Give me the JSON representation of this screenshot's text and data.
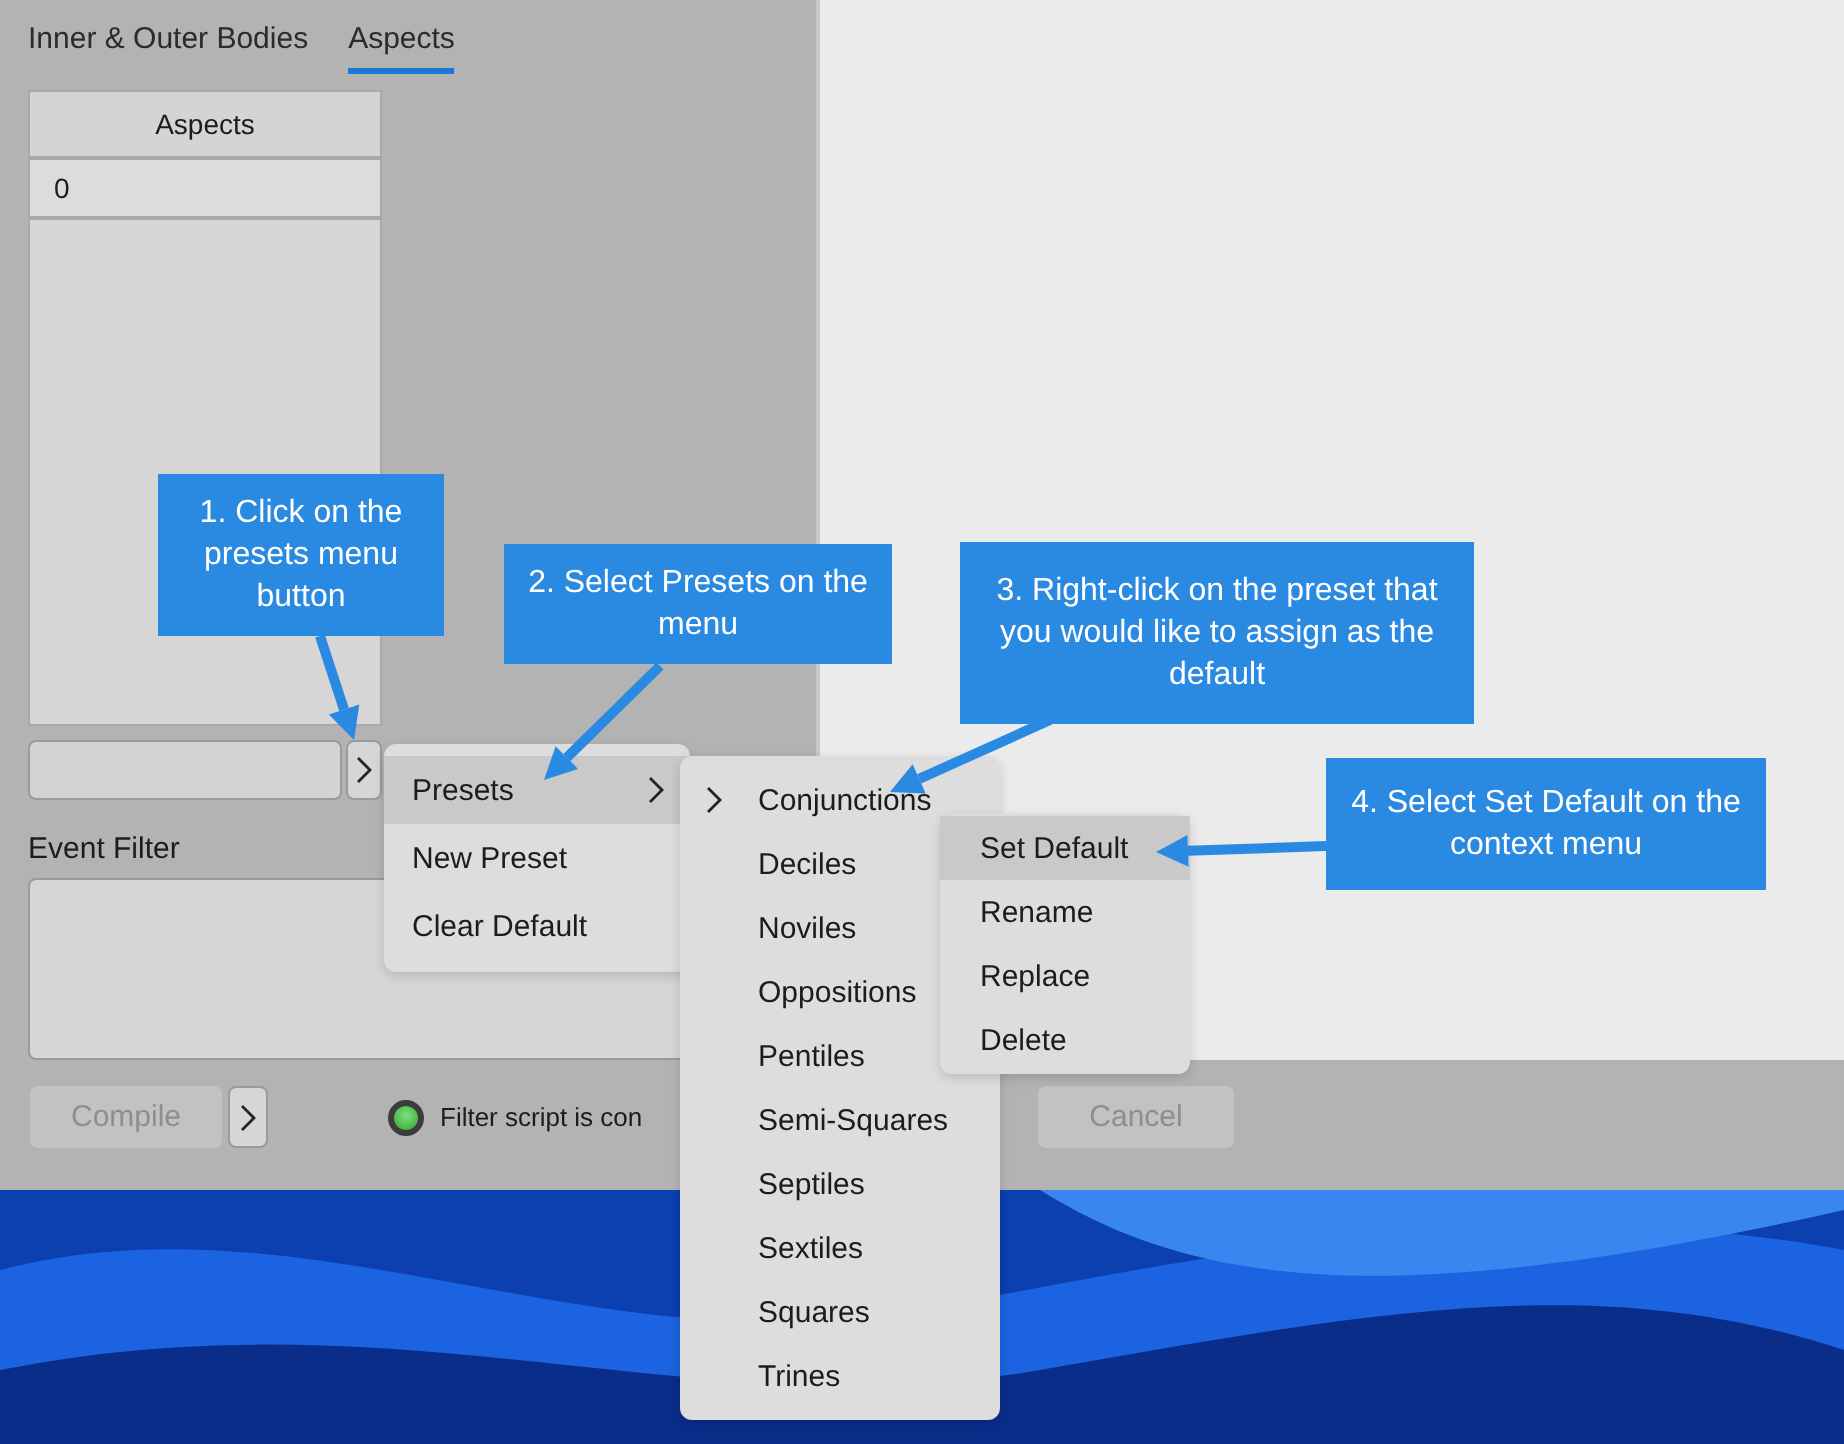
{
  "tabs": [
    {
      "label": "Inner & Outer Bodies",
      "selected": false
    },
    {
      "label": "Aspects",
      "selected": true
    }
  ],
  "aspects_table": {
    "columns": [
      "Aspects"
    ],
    "rows": [
      [
        "0"
      ]
    ]
  },
  "event_filter": {
    "label": "Event Filter"
  },
  "buttons": [
    {
      "label": "Compile",
      "disabled": true
    },
    {
      "label": "Cancel",
      "disabled": true
    }
  ],
  "status": {
    "text": "Filter script is con",
    "ok": true
  },
  "menus": [
    {
      "kind": "main",
      "items": [
        {
          "label": "Presets",
          "selected": true,
          "submenu": true
        },
        {
          "label": "New Preset",
          "selected": false,
          "submenu": false
        },
        {
          "label": "Clear Default",
          "selected": false,
          "submenu": false
        }
      ]
    },
    {
      "kind": "presets",
      "items": [
        {
          "label": "Conjunctions",
          "selected": false,
          "expanded": true
        },
        {
          "label": "Deciles",
          "selected": false,
          "expanded": false
        },
        {
          "label": "Noviles",
          "selected": false,
          "expanded": false
        },
        {
          "label": "Oppositions",
          "selected": false,
          "expanded": false
        },
        {
          "label": "Pentiles",
          "selected": false,
          "expanded": false
        },
        {
          "label": "Semi-Squares",
          "selected": false,
          "expanded": false
        },
        {
          "label": "Septiles",
          "selected": false,
          "expanded": false
        },
        {
          "label": "Sextiles",
          "selected": false,
          "expanded": false
        },
        {
          "label": "Squares",
          "selected": false,
          "expanded": false
        },
        {
          "label": "Trines",
          "selected": false,
          "expanded": false
        }
      ]
    },
    {
      "kind": "context",
      "items": [
        {
          "label": "Set Default",
          "selected": true
        },
        {
          "label": "Rename",
          "selected": false
        },
        {
          "label": "Replace",
          "selected": false
        },
        {
          "label": "Delete",
          "selected": false
        }
      ]
    }
  ],
  "callouts": [
    {
      "text": "1. Click on the presets menu button"
    },
    {
      "text": "2. Select Presets on the menu"
    },
    {
      "text": "3. Right-click on the preset that you would like to assign as the default"
    },
    {
      "text": "4. Select Set Default on the context menu"
    }
  ]
}
